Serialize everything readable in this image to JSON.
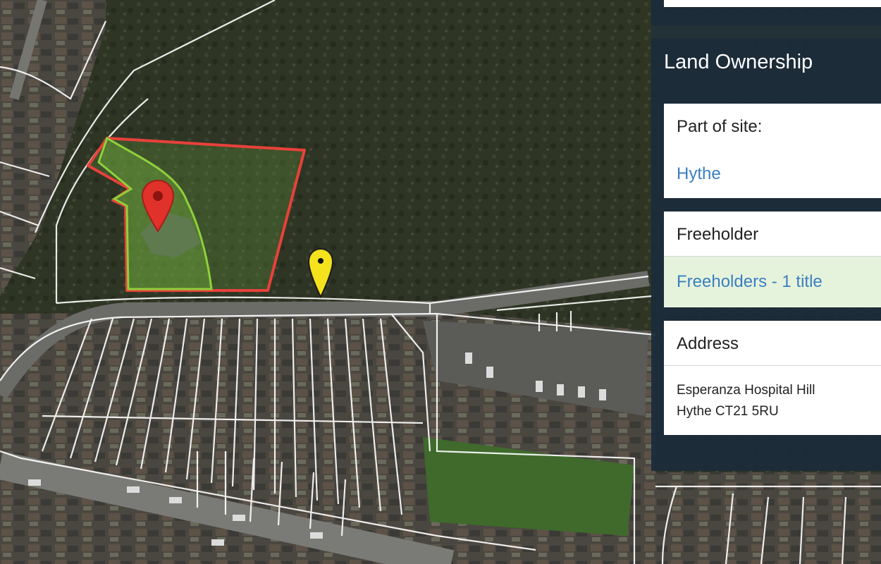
{
  "panel": {
    "title": "Land Ownership",
    "part_of_site": {
      "label": "Part of site:",
      "value": "Hythe"
    },
    "freeholder": {
      "label": "Freeholder",
      "link": "Freeholders - 1 title"
    },
    "address": {
      "label": "Address",
      "line1": "Esperanza Hospital Hill",
      "line2": "Hythe CT21 5RU"
    }
  },
  "map": {
    "markers": [
      {
        "name": "selected-location",
        "color": "#e0312a",
        "icon": "map-pin-icon"
      },
      {
        "name": "nearby-location",
        "color": "#f3e21c",
        "icon": "map-pin-icon"
      }
    ],
    "boundaries": {
      "site_outline_color": "#e8413a",
      "title_outline_color": "#8fd13a",
      "parcel_color": "#ffffff"
    }
  }
}
